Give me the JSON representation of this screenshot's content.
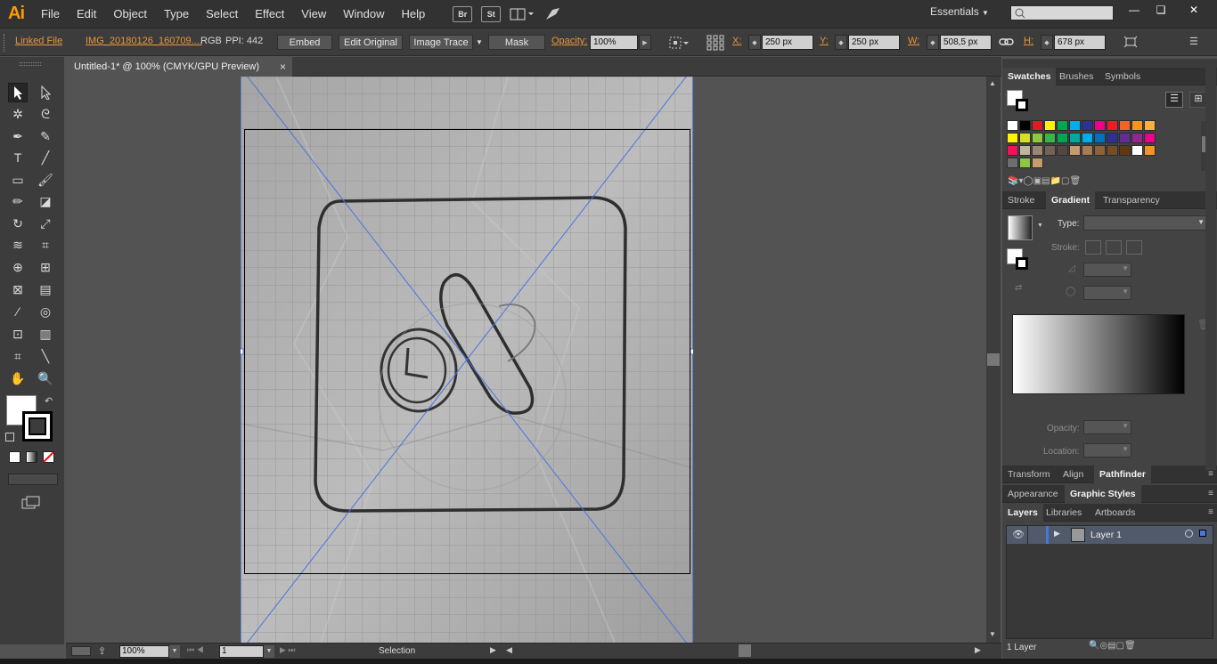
{
  "app": {
    "logo": "Ai"
  },
  "menus": [
    "File",
    "Edit",
    "Object",
    "Type",
    "Select",
    "Effect",
    "View",
    "Window",
    "Help"
  ],
  "menubar_icons": {
    "br": "Br",
    "st": "St",
    "arrange": "arrange-documents-icon",
    "gpu": "gpu-performance-icon"
  },
  "workspace": {
    "label": "Essentials"
  },
  "window_controls": {
    "minimize": "—",
    "restore": "❏",
    "close": "✕"
  },
  "control": {
    "linked_file": "Linked File",
    "filename": "IMG_20180126_160709....",
    "color_mode": "RGB",
    "ppi": "PPI: 442",
    "embed": "Embed",
    "edit_original": "Edit Original",
    "image_trace": "Image Trace",
    "mask": "Mask",
    "opacity_label": "Opacity:",
    "opacity_value": "100%",
    "x_label": "X:",
    "x_value": "250 px",
    "y_label": "Y:",
    "y_value": "250 px",
    "w_label": "W:",
    "w_value": "508,5 px",
    "h_label": "H:",
    "h_value": "678 px"
  },
  "document": {
    "tab_title": "Untitled-1* @ 100% (CMYK/GPU Preview)",
    "close": "×"
  },
  "status": {
    "zoom": "100%",
    "artboard": "1",
    "tool": "Selection"
  },
  "panels": {
    "swatches_group": {
      "tabs": [
        "Swatches",
        "Brushes",
        "Symbols"
      ]
    },
    "gradient_group": {
      "tabs": [
        "Stroke",
        "Gradient",
        "Transparency"
      ],
      "type_label": "Type:",
      "stroke_label": "Stroke:",
      "opacity_label": "Opacity:",
      "location_label": "Location:"
    },
    "pathfinder_group": {
      "tabs": [
        "Transform",
        "Align",
        "Pathfinder"
      ]
    },
    "graphic_styles_group": {
      "tabs": [
        "Appearance",
        "Graphic Styles"
      ]
    },
    "layers_group": {
      "tabs": [
        "Layers",
        "Libraries",
        "Artboards"
      ],
      "layer_name": "Layer 1",
      "count": "1 Layer"
    }
  },
  "swatch_colors": [
    [
      "#ffffff",
      "#000000",
      "#e11b22",
      "#fff200",
      "#00a651",
      "#00aeef",
      "#2e3192",
      "#ec008c",
      "#ed1c24",
      "#f26522",
      "#f7941d",
      "#fbaf3f"
    ],
    [
      "#fff200",
      "#d7df23",
      "#8dc63f",
      "#39b54a",
      "#00a651",
      "#00a99d",
      "#00aeef",
      "#0072bc",
      "#2e3192",
      "#662d91",
      "#92278f",
      "#ec008c"
    ],
    [
      "#ed145b",
      "#c2b59b",
      "#998675",
      "#736357",
      "#534741",
      "#c69c6d",
      "#a67c52",
      "#8c6239",
      "#754c24",
      "#603913",
      "#ffffff",
      "#f7941d"
    ],
    [
      "#6d6e70",
      "#8dc63f",
      "#c69c6d"
    ]
  ],
  "colors": {
    "accent_orange": "#e8963a",
    "guide_blue": "#4a74e0",
    "selection_fill": "#4a74e0"
  }
}
